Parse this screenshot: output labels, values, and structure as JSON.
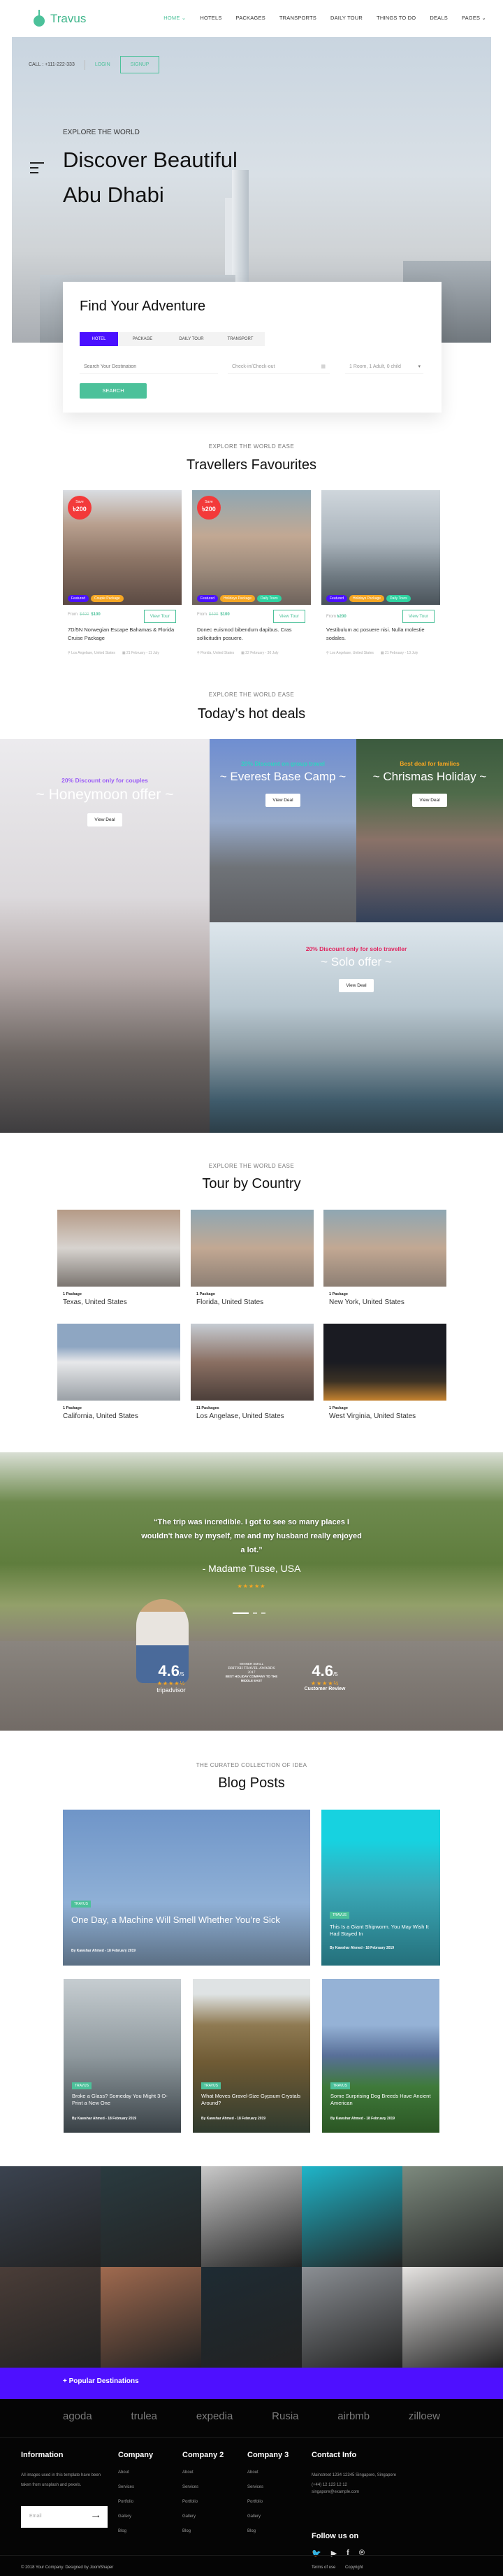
{
  "brand": {
    "name": "Travus",
    "accent": "#4cc19a",
    "purple": "#4e10ff"
  },
  "nav": {
    "items": [
      "HOME ⌄",
      "HOTELS",
      "PACKAGES",
      "TRANSPORTS",
      "DAILY TOUR",
      "THINGS TO DO",
      "DEALS",
      "PAGES ⌄"
    ]
  },
  "topbar": {
    "call": "CALL : +111-222-333",
    "login": "LOGIN",
    "signup": "SIGNUP"
  },
  "hero": {
    "kicker": "EXPLORE THE WORLD",
    "title_line1": "Discover Beautiful",
    "title_line2": "Abu Dhabi"
  },
  "search": {
    "title": "Find Your Adventure",
    "tabs": [
      "HOTEL",
      "PACKAGE",
      "DAILY TOUR",
      "TRANSPORT"
    ],
    "active_tab": "HOTEL",
    "destination_placeholder": "Search Your Destination",
    "dates_placeholder": "Check-in/Check-out",
    "guests_value": "1 Room, 1 Adult, 0 child",
    "button": "SEARCH"
  },
  "favourites": {
    "kicker": "EXPLORE THE WORLD EASE",
    "title": "Travellers Favourites",
    "cards": [
      {
        "save_label": "Save",
        "save_amount": "৳200",
        "tags": [
          "Featured",
          "Couple Package"
        ],
        "from": "From",
        "old_price": "$400",
        "price": "$100",
        "button": "View Tour",
        "title": "7D/5N Norwegian Escape Bahamas & Florida Cruise Package",
        "location": "Los Angelase, United States",
        "dates": "21 February - 11 July"
      },
      {
        "save_label": "Save",
        "save_amount": "৳200",
        "tags": [
          "Featured",
          "Holidays Package",
          "Daily Tours"
        ],
        "from": "From",
        "old_price": "$400",
        "price": "$100",
        "button": "View Tour",
        "title": "Donec euismod bibendum dapibus. Cras sollicitudin posuere.",
        "location": "Florida, United States",
        "dates": "22 February - 30 July"
      },
      {
        "tags": [
          "Featured",
          "Holidays Package",
          "Daily Tours"
        ],
        "from": "From",
        "price": "৳200",
        "button": "View Tour",
        "title": "Vestibulum ac posuere nisi. Nulla molestie sodales.",
        "location": "Los Angelase, United States",
        "dates": "21 February - 13 July"
      }
    ]
  },
  "deals": {
    "kicker": "EXPLORE THE WORLD EASE",
    "title": "Today’s hot deals",
    "items": [
      {
        "subtitle": "20% Discount only for couples",
        "title": "~ Honeymoon offer ~",
        "button": "View Deal",
        "color": "#9b5cf6"
      },
      {
        "subtitle": "20% Discount on group travel",
        "title": "~ Everest Base Camp ~",
        "button": "View Deal",
        "color": "#2ed3c0"
      },
      {
        "subtitle": "Best deal for families",
        "title": "~ Chrismas Holiday ~",
        "button": "View Deal",
        "color": "#f5a623"
      },
      {
        "subtitle": "20% Discount only for solo traveller",
        "title": "~ Solo offer ~",
        "button": "View Deal",
        "color": "#e0245e"
      }
    ]
  },
  "countries": {
    "kicker": "EXPLORE THE WORLD EASE",
    "title": "Tour by Country",
    "items": [
      {
        "packages": "1 Package",
        "name": "Texas, United States"
      },
      {
        "packages": "1 Package",
        "name": "Florida, United States"
      },
      {
        "packages": "1 Package",
        "name": "New York, United States"
      },
      {
        "packages": "1 Package",
        "name": "California, United States"
      },
      {
        "packages": "11 Packages",
        "name": "Los Angelase, United States"
      },
      {
        "packages": "1 Package",
        "name": "West Virginia, United States"
      }
    ]
  },
  "testimonial": {
    "quote": "“The trip was incredible. I got to see so many places I wouldn't have by myself, me and my husband really enjoyed a lot.”",
    "author": "- Madame Tusse, USA",
    "stars": "★★★★★",
    "slide": 1,
    "slides": 3,
    "ratings": [
      {
        "score": "4.6",
        "out_of": "/5",
        "stars": "★★★★½",
        "label": "tripadvisor"
      },
      {
        "award_line1": "WINNER SMALL",
        "award_line2": "BRITISH TRAVEL AWARDS 2017",
        "award_line3": "BEST HOLIDAY COMPANY TO THE MIDDLE EAST"
      },
      {
        "score": "4.6",
        "out_of": "/5",
        "stars": "★★★★½",
        "label": "Customer Review"
      }
    ]
  },
  "blog": {
    "kicker": "THE CURATED COLLECTION OF IDEA",
    "title": "Blog Posts",
    "posts": [
      {
        "tag": "TRAVUS",
        "title": "One Day, a Machine Will Smell Whether You’re Sick",
        "meta": "By Kawshar Ahmed -  18 February 2019"
      },
      {
        "tag": "TRAVUS",
        "title": "This Is a Giant Shipworm. You May Wish It Had Stayed In",
        "meta": "By Kawshar Ahmed -  18 February 2019"
      },
      {
        "tag": "TRAVUS",
        "title": "Broke a Glass? Someday You Might 3-D-Print a New One",
        "meta": "By Kawshar Ahmed -  18 February 2019"
      },
      {
        "tag": "TRAVUS",
        "title": "What Moves Gravel-Size Gypsum Crystals Around?",
        "meta": "By Kawshar Ahmed -  18 February 2019"
      },
      {
        "tag": "TRAVUS",
        "title": "Some Surprising Dog Breeds Have Ancient American",
        "meta": "By Kawshar Ahmed -  18 February 2019"
      }
    ]
  },
  "popular": {
    "label": "+ Popular Destinations"
  },
  "footer": {
    "brands": [
      "agoda",
      "trulea",
      "expedia",
      "Rusia",
      "airbmb",
      "zilloew"
    ],
    "information": {
      "title": "Information",
      "text": "All images used in this template have been taken from unsplash and pexels.",
      "email_placeholder": "Email"
    },
    "columns": [
      {
        "title": "Company",
        "links": [
          "About",
          "Services",
          "Portfolio",
          "Gallery",
          "Blog"
        ]
      },
      {
        "title": "Company 2",
        "links": [
          "About",
          "Services",
          "Portfolio",
          "Gallery",
          "Blog"
        ]
      },
      {
        "title": "Company 3",
        "links": [
          "About",
          "Services",
          "Portfolio",
          "Gallery",
          "Blog"
        ]
      }
    ],
    "contact": {
      "title": "Contact Info",
      "address": "Mainstreet 1234 12345 Singapore, Singapore (+44) 12 123 12 12",
      "email": "singapore@example.com",
      "follow": "Follow us on",
      "socials": [
        "twitter-icon",
        "youtube-icon",
        "facebook-icon",
        "pinterest-icon"
      ]
    },
    "copyright": "© 2018 Your Company. Designed by JoomShaper",
    "terms": "Terms of use",
    "copyright_link": "Copyright"
  }
}
